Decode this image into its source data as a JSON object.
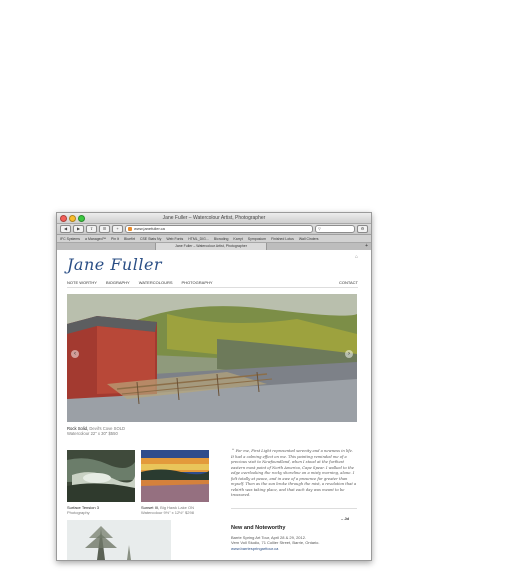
{
  "browser": {
    "window_title": "Jane Fuller – Watercolour Artist, Photographer",
    "url": "www.janefuller.ca",
    "tab_title": "Jane Fuller – Watercolour Artist, Photographer",
    "bookmarks": [
      "IFC Systems",
      "a Managed™",
      "Pin It",
      "Bluefirt",
      "CSE Stats Ny",
      "Web Fonts",
      "HTML_DIG...",
      "Bicroding",
      "Karryt",
      "Symposium",
      "Finished Lotus",
      "Wall Cinders"
    ]
  },
  "site": {
    "logo": "Jane Fuller",
    "nav": [
      "NOTE WORTHY",
      "BIOGRAPHY",
      "WATERCOLOURS",
      "PHOTOGRAPHY"
    ],
    "contact": "CONTACT",
    "hero": {
      "title": "Rock Solid,",
      "place": "Devil's Cove",
      "sold": "SOLD",
      "details": "Watercolour 22\" x 30\" $550"
    },
    "thumbs": [
      {
        "title": "Surface Tension 3",
        "sub": "Photography"
      },
      {
        "title": "Sunset III,",
        "place": "Big Hawk Lake",
        "tail": "ON",
        "sub": "Watercolour 9½\" x 12½\" $298"
      }
    ],
    "quote": "For me, First Light represented serenity and a newness in life. It had a calming effect on me. This painting reminded me of a precious visit to Newfoundland, when I stood at the furthest eastern most point of North America, Cape Spear. I walked to the edge overlooking the rocky shoreline on a misty morning, alone. I felt totally at peace, and in awe of a presence far greater than myself. Then as the sun broke through the mist, a revelation that a rebirth was taking place, and that each day was meant to be treasured.",
    "quote_sign": "– Jd",
    "news": {
      "heading": "New and Noteworthy",
      "line1": "Barrie Spring Art Tour, April 28 & 29, 2012.",
      "line2": "Vern Voll Studio, 71 Collier Street, Barrie, Ontario.",
      "link": "www.barriespringarttour.ca"
    }
  }
}
